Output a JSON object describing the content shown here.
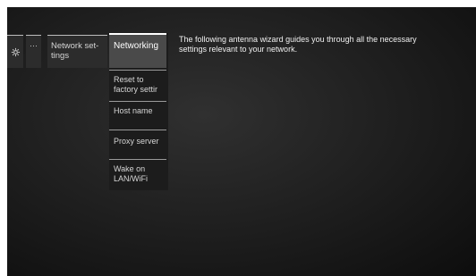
{
  "breadcrumb": {
    "settings_icon": "gear-icon",
    "more_label": "···",
    "network_settings_label": "Network set-\ntings"
  },
  "submenu": {
    "items": [
      {
        "label": "Networking",
        "selected": true
      },
      {
        "label": "Reset to factory settings"
      },
      {
        "label": "Host name"
      },
      {
        "label": "Proxy server"
      },
      {
        "label": "Wake on LAN/WiFi"
      }
    ],
    "item_line1": [
      "Networking",
      "Reset to",
      "Host name",
      "Proxy server",
      "Wake on"
    ],
    "item_line2": [
      "",
      "factory settir",
      "",
      "",
      "LAN/WiFi"
    ]
  },
  "description": "The following antenna wizard guides you through all the necessary settings relevant to your network.",
  "colors": {
    "background": "#1d1d1d",
    "tile": "#2c2c2c",
    "selected": "#4a4a4a"
  }
}
